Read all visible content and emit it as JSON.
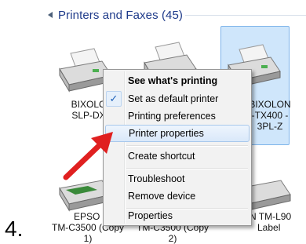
{
  "step_number": "4.",
  "group": {
    "title": "Printers and Faxes (45)"
  },
  "printers": [
    {
      "line1": "BIXOLO",
      "line2": "SLP-DX"
    },
    {
      "line1": "BIXOLON",
      "line2": "-TX400 -",
      "line3": "3PL-Z"
    },
    {
      "line1": "EPSO",
      "line2": "TM-C3500 (Copy",
      "line3": "1)"
    },
    {
      "line1": "TM-C3500 (Copy",
      "line2": "2)"
    },
    {
      "line1": "N TM-L90",
      "line2": "Label"
    }
  ],
  "context_menu": {
    "items": [
      {
        "label": "See what's printing",
        "bold": true
      },
      {
        "label": "Set as default printer",
        "checked": true
      },
      {
        "label": "Printing preferences"
      },
      {
        "label": "Printer properties",
        "highlighted": true
      },
      {
        "label": "Create shortcut"
      },
      {
        "label": "Troubleshoot"
      },
      {
        "label": "Remove device"
      },
      {
        "label": "Properties"
      }
    ],
    "check_mark": "✓"
  },
  "colors": {
    "arrow": "#e02020",
    "selection": "#cfe6fb",
    "header_text": "#1e3a8a"
  }
}
